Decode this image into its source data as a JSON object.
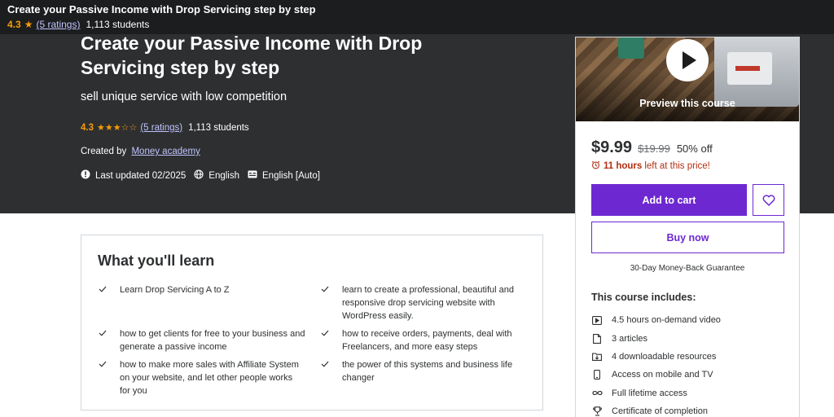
{
  "sticky": {
    "title": "Create your Passive Income with Drop Servicing step by step",
    "rating": "4.3",
    "ratings_link": "(5 ratings)",
    "students": "1,113 students"
  },
  "hero": {
    "title": "Create your Passive Income with Drop Servicing step by step",
    "subtitle": "sell unique service with low competition",
    "rating": "4.3",
    "stars": "★★★☆☆",
    "ratings_link": "(5 ratings)",
    "students": "1,113 students",
    "created_label": "Created by",
    "author": "Money academy",
    "last_updated": "Last updated 02/2025",
    "language": "English",
    "captions": "English [Auto]"
  },
  "sidebar": {
    "preview_label": "Preview this course",
    "price": "$9.99",
    "original_price": "$19.99",
    "discount": "50% off",
    "timer_hours": "11 hours",
    "timer_rest": "left at this price!",
    "add_to_cart": "Add to cart",
    "buy_now": "Buy now",
    "guarantee": "30-Day Money-Back Guarantee",
    "includes_title": "This course includes:",
    "includes": [
      {
        "icon": "video-icon",
        "label": "4.5 hours on-demand video"
      },
      {
        "icon": "article-icon",
        "label": "3 articles"
      },
      {
        "icon": "download-icon",
        "label": "4 downloadable resources"
      },
      {
        "icon": "mobile-icon",
        "label": "Access on mobile and TV"
      },
      {
        "icon": "infinity-icon",
        "label": "Full lifetime access"
      },
      {
        "icon": "trophy-icon",
        "label": "Certificate of completion"
      }
    ]
  },
  "learn": {
    "title": "What you'll learn",
    "items": [
      "Learn Drop Servicing A to Z",
      "learn to create a professional, beautiful and responsive drop servicing website with WordPress easily.",
      "how to get clients for free to your business and generate a passive income",
      "how to receive orders, payments, deal with Freelancers, and more easy steps",
      "how to make more sales with Affiliate System on your website, and let other people works for you",
      "the power of this systems and business life changer"
    ]
  },
  "colors": {
    "hero_bg": "#2d2f31",
    "accent_purple": "#6d28d2",
    "rating_orange": "#f69c08",
    "timer_red": "#b32d0f",
    "link_lavender": "#c0c4fc"
  }
}
